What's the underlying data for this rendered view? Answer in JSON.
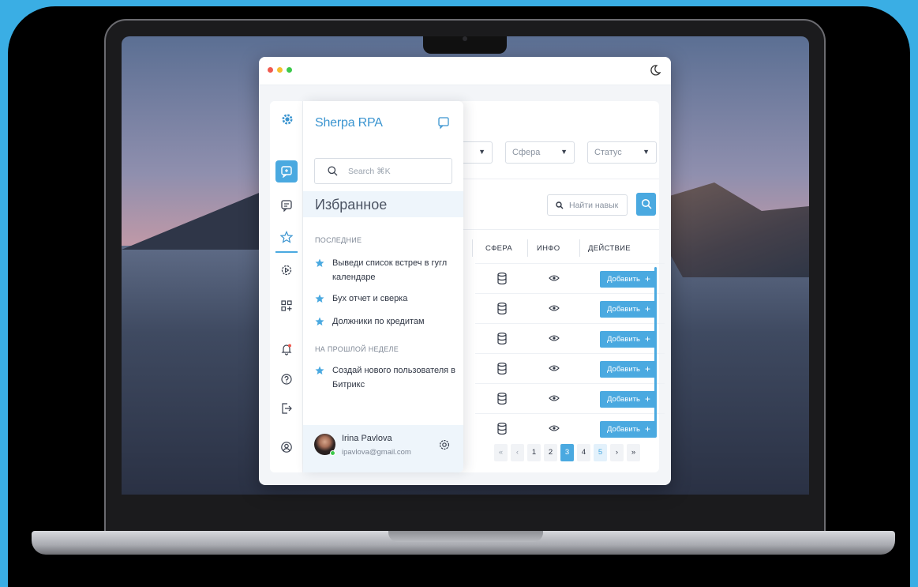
{
  "app": {
    "brand": "Sherpa RPA",
    "search_placeholder": "Search ⌘K",
    "favorites_title": "Избранное",
    "sections": [
      {
        "title": "ПОСЛЕДНИЕ",
        "items": [
          "Выведи список встреч в гугл календаре",
          "Бух отчет и сверка",
          "Должники по кредитам"
        ]
      },
      {
        "title": "НА ПРОШЛОЙ НЕДЕЛЕ",
        "items": [
          "Создай нового пользователя в Битрикс"
        ]
      }
    ],
    "user": {
      "name": "Irina Pavlova",
      "email": "ipavlova@gmail.com"
    }
  },
  "filters": {
    "sfera": "Сфера",
    "status": "Статус"
  },
  "skill_search": {
    "placeholder": "Найти навык"
  },
  "table": {
    "headers": [
      "СФЕРА",
      "ИНФО",
      "ДЕЙСТВИЕ"
    ],
    "row_count": 6,
    "add_label": "Добавить",
    "add_plus": "+"
  },
  "pagination": {
    "first": "«",
    "prev": "‹",
    "pages": [
      "1",
      "2",
      "3",
      "4",
      "5"
    ],
    "next": "›",
    "last": "»",
    "current": "3"
  },
  "colors": {
    "accent": "#4aa9e0",
    "brand": "#3a94d0",
    "screen_frame": "#3aaee4"
  },
  "icons": {
    "rail": [
      "gear-logo-icon",
      "chat-icon",
      "message-icon",
      "star-icon",
      "play-settings-icon",
      "add-app-icon",
      "bell-icon",
      "help-icon",
      "logout-icon",
      "profile-icon"
    ]
  }
}
